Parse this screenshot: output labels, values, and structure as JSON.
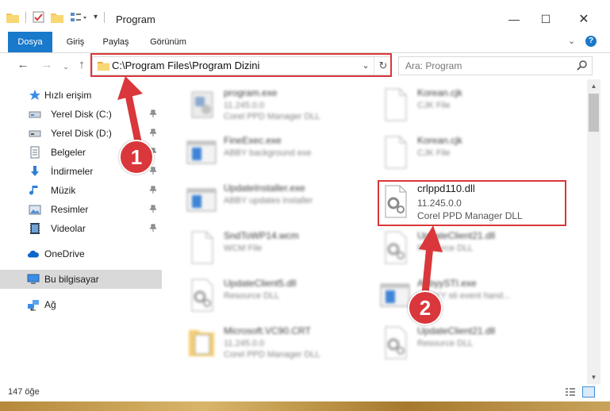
{
  "window": {
    "title": "Program",
    "controls": {
      "minimize": "—",
      "maximize": "☐",
      "close": "✕"
    }
  },
  "ribbon": {
    "tabs": [
      "Dosya",
      "Giriş",
      "Paylaş",
      "Görünüm"
    ],
    "active_tab": "Dosya",
    "help_label": "?"
  },
  "navigation": {
    "address_path": "C:\\Program Files\\Program Dizini",
    "search_placeholder": "Ara: Program"
  },
  "sidebar": {
    "quick_access": "Hızlı erişim",
    "items": [
      {
        "label": "Yerel Disk (C:)",
        "icon": "drive-icon",
        "pinned": true
      },
      {
        "label": "Yerel Disk (D:)",
        "icon": "drive-icon",
        "pinned": true
      },
      {
        "label": "Belgeler",
        "icon": "documents-icon",
        "pinned": true
      },
      {
        "label": "İndirmeler",
        "icon": "download-icon",
        "pinned": true
      },
      {
        "label": "Müzik",
        "icon": "music-icon",
        "pinned": true
      },
      {
        "label": "Resimler",
        "icon": "pictures-icon",
        "pinned": true
      },
      {
        "label": "Videolar",
        "icon": "videos-icon",
        "pinned": true
      }
    ],
    "onedrive": "OneDrive",
    "this_pc": "Bu bilgisayar",
    "network": "Ağ"
  },
  "files": {
    "left": [
      {
        "name": "program.exe",
        "line2": "11.245.0.0",
        "line3": "Corel PPD Manager DLL",
        "icon": "exe-app-icon"
      },
      {
        "name": "FineExec.exe",
        "line2": "ABBY background exe",
        "line3": "",
        "icon": "exe-window-icon"
      },
      {
        "name": "UpdateInstaller.exe",
        "line2": "ABBY updates installer",
        "line3": "",
        "icon": "exe-window-icon"
      },
      {
        "name": "SndToWP14.wcm",
        "line2": "WCM File",
        "line3": "",
        "icon": "blank-file-icon"
      },
      {
        "name": "UpdateClient5.dll",
        "line2": "Resource DLL",
        "line3": "",
        "icon": "dll-gear-icon"
      },
      {
        "name": "Microsoft.VC90.CRT",
        "line2": "11.245.0.0",
        "line3": "Corel PPD Manager DLL",
        "icon": "folder-doc-icon"
      }
    ],
    "right": [
      {
        "name": "Korean.cjk",
        "line2": "CJK File",
        "line3": "",
        "icon": "blank-file-icon"
      },
      {
        "name": "Korean.cjk",
        "line2": "CJK File",
        "line3": "",
        "icon": "blank-file-icon"
      },
      {
        "name": "crlppd110.dll",
        "line2": "11.245.0.0",
        "line3": "Corel PPD Manager DLL",
        "icon": "dll-gear-icon",
        "focus": true
      },
      {
        "name": "UpdateClient21.dll",
        "line2": "Resource DLL",
        "line3": "",
        "icon": "dll-gear-icon"
      },
      {
        "name": "AbbyySTI.exe",
        "line2": "ABBYY sti event hand...",
        "line3": "",
        "icon": "exe-window-icon"
      },
      {
        "name": "UpdateClient21.dll",
        "line2": "Resource DLL",
        "line3": "",
        "icon": "dll-gear-icon"
      }
    ]
  },
  "status": {
    "item_count": "147 öğe"
  },
  "callouts": {
    "one": "1",
    "two": "2"
  },
  "colors": {
    "accent": "#1979ca",
    "highlight": "#d9373b",
    "selected": "#d9d9d9"
  }
}
